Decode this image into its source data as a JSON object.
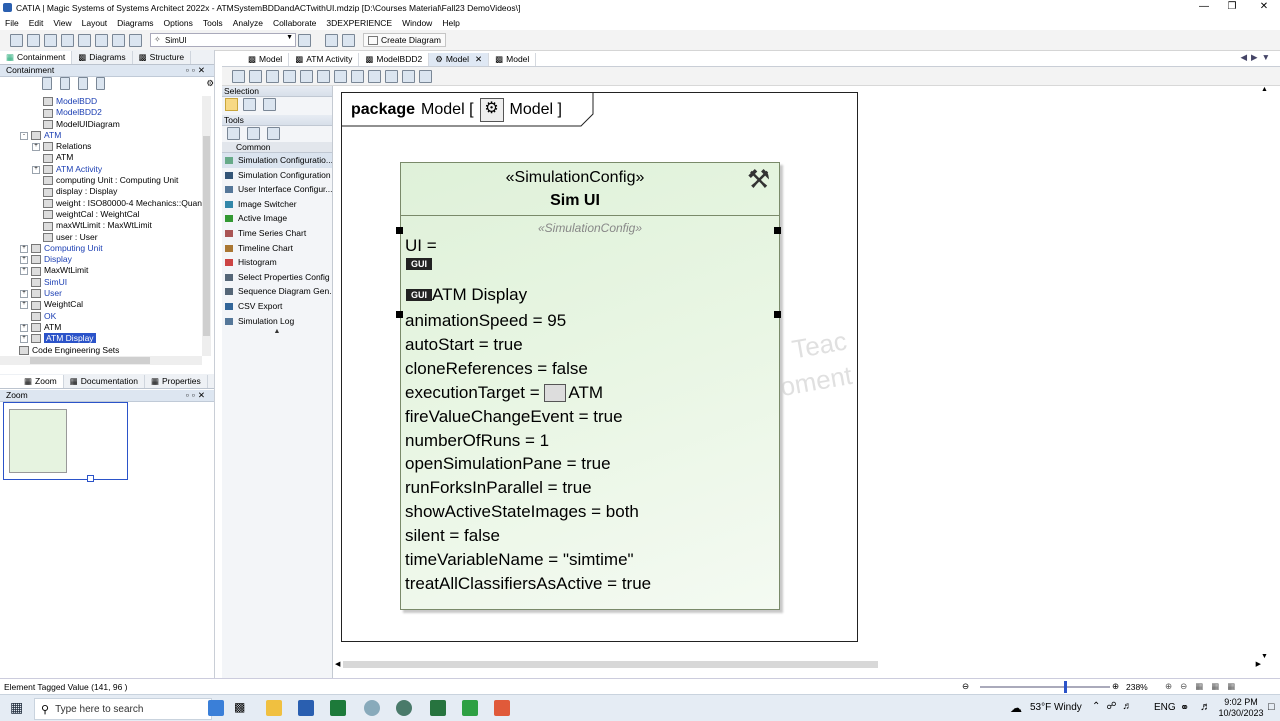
{
  "window": {
    "title": "CATIA | Magic Systems of Systems Architect 2022x - ATMSystemBDDandACTwithUI.mdzip [D:\\Courses Material\\Fall23 DemoVideos\\]"
  },
  "menu": [
    "File",
    "Edit",
    "View",
    "Layout",
    "Diagrams",
    "Options",
    "Tools",
    "Analyze",
    "Collaborate",
    "3DEXPERIENCE",
    "Window",
    "Help"
  ],
  "toolbar": {
    "combo_value": "SimUI",
    "create_diagram": "Create Diagram"
  },
  "left_tabs": [
    "Containment",
    "Diagrams",
    "Structure"
  ],
  "containment": {
    "header": "Containment",
    "tree": [
      {
        "label": "ModelBDD",
        "ind": 1,
        "cls": "blue",
        "ex": ""
      },
      {
        "label": "ModelBDD2",
        "ind": 1,
        "cls": "blue",
        "ex": ""
      },
      {
        "label": "ModelUIDiagram",
        "ind": 1,
        "cls": "",
        "ex": ""
      },
      {
        "label": "ATM",
        "ind": 0,
        "cls": "blue",
        "ex": "-"
      },
      {
        "label": "Relations",
        "ind": 1,
        "cls": "",
        "ex": "+"
      },
      {
        "label": "ATM",
        "ind": 1,
        "cls": "",
        "ex": ""
      },
      {
        "label": "ATM Activity",
        "ind": 1,
        "cls": "blue",
        "ex": "+"
      },
      {
        "label": "computing Unit : Computing Unit",
        "ind": 1,
        "cls": "",
        "ex": ""
      },
      {
        "label": "display : Display",
        "ind": 1,
        "cls": "",
        "ex": ""
      },
      {
        "label": "weight : ISO80000-4 Mechanics::Quantities::m",
        "ind": 1,
        "cls": "",
        "ex": ""
      },
      {
        "label": "weightCal : WeightCal",
        "ind": 1,
        "cls": "",
        "ex": ""
      },
      {
        "label": "maxWtLimit : MaxWtLimit",
        "ind": 1,
        "cls": "",
        "ex": ""
      },
      {
        "label": "user : User",
        "ind": 1,
        "cls": "",
        "ex": ""
      },
      {
        "label": "Computing Unit",
        "ind": 0,
        "cls": "blue",
        "ex": "+"
      },
      {
        "label": "Display",
        "ind": 0,
        "cls": "blue",
        "ex": "+"
      },
      {
        "label": "MaxWtLimit",
        "ind": 0,
        "cls": "",
        "ex": "+"
      },
      {
        "label": "SimUI",
        "ind": 0,
        "cls": "blue",
        "ex": ""
      },
      {
        "label": "User",
        "ind": 0,
        "cls": "blue",
        "ex": "+"
      },
      {
        "label": "WeightCal",
        "ind": 0,
        "cls": "",
        "ex": "+"
      },
      {
        "label": "OK",
        "ind": 0,
        "cls": "blue",
        "ex": ""
      },
      {
        "label": "ATM",
        "ind": 0,
        "cls": "",
        "ex": "+"
      },
      {
        "label": "ATM Display",
        "ind": 0,
        "cls": "sel",
        "ex": "+"
      },
      {
        "label": "Code Engineering Sets",
        "ind": -1,
        "cls": "",
        "ex": ""
      }
    ]
  },
  "bottom_tabs": [
    "Zoom",
    "Documentation",
    "Properties"
  ],
  "zoom_header": "Zoom",
  "palette": {
    "selection": "Selection",
    "tools": "Tools",
    "group": "Common",
    "items": [
      "Simulation Configuratio...",
      "Simulation Configuration",
      "User Interface Configur...",
      "Image Switcher",
      "Active Image",
      "Time Series Chart",
      "Timeline Chart",
      "Histogram",
      "Select Properties Config",
      "Sequence Diagram Gen...",
      "CSV Export",
      "Simulation Log"
    ]
  },
  "editor_tabs": [
    {
      "label": "Model",
      "active": false
    },
    {
      "label": "ATM Activity",
      "active": false
    },
    {
      "label": "ModelBDD2",
      "active": false
    },
    {
      "label": "Model",
      "active": true
    },
    {
      "label": "Model",
      "active": false
    }
  ],
  "diagram": {
    "frame_kind": "package",
    "frame_name": "Model [",
    "frame_icon_label": "Model ]",
    "stereotype": "«SimulationConfig»",
    "name": "Sim UI",
    "compartment_label": "«SimulationConfig»",
    "ui_label": "UI =",
    "gui": "GUI",
    "atm_display": "ATM Display",
    "exec_prefix": "executionTarget = ",
    "exec_value": "ATM",
    "props": [
      "animationSpeed = 95",
      "autoStart = true",
      "cloneReferences = false",
      "executionTarget = ATM",
      "fireValueChangeEvent = true",
      "numberOfRuns = 1",
      "openSimulationPane = true",
      "runForksInParallel = true",
      "showActiveStateImages = both",
      "silent = false",
      "timeVariableName = \"simtime\"",
      "treatAllClassifiersAsActive = true"
    ],
    "watermark": [
      "Teac",
      "oment"
    ]
  },
  "status": {
    "text": "Element Tagged Value (141, 96 )",
    "zoom": "238%"
  },
  "taskbar": {
    "search_placeholder": "Type here to search",
    "weather": "53°F  Windy",
    "lang": "ENG",
    "time": "9:02 PM",
    "date": "10/30/2023"
  }
}
